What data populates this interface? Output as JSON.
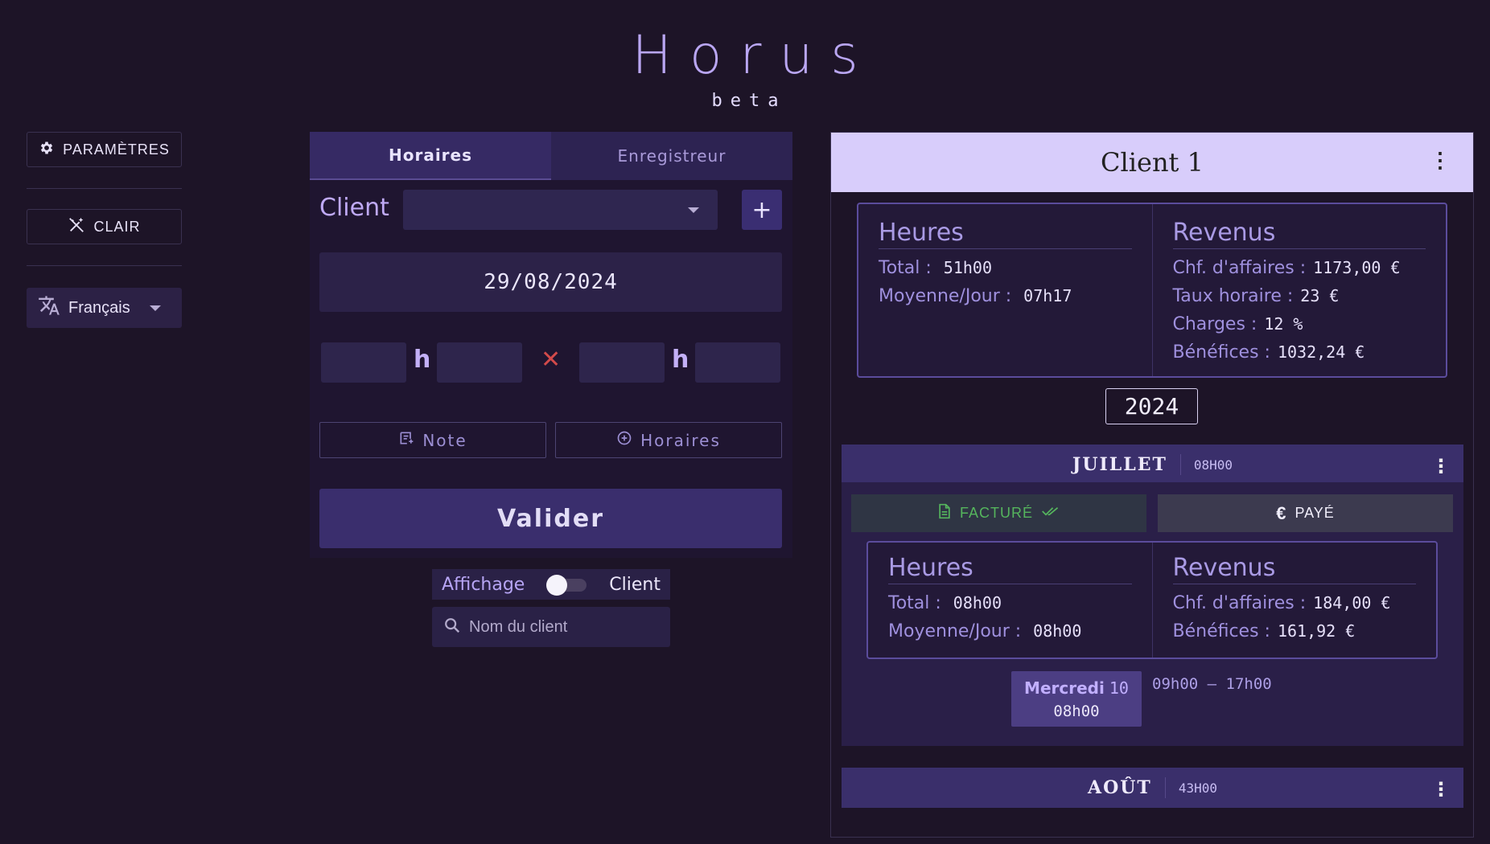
{
  "app": {
    "title": "Horus",
    "subtitle": "beta"
  },
  "sidebar": {
    "settings_label": "PARAMÈTRES",
    "theme_label": "CLAIR",
    "language_label": "Français"
  },
  "editor": {
    "tabs": [
      {
        "label": "Horaires",
        "active": true
      },
      {
        "label": "Enregistreur",
        "active": false
      }
    ],
    "client_label": "Client",
    "client_select_value": "",
    "date_value": "29/08/2024",
    "hour_separator": "h",
    "note_button": "Note",
    "hours_button": "Horaires",
    "validate_button": "Valider",
    "view_toggle": {
      "left_label": "Affichage",
      "right_label": "Client",
      "on": false
    },
    "search_placeholder": "Nom du client"
  },
  "client_panel": {
    "client_name": "Client 1",
    "summary": {
      "hours_title": "Heures",
      "total_label": "Total :",
      "total_value": "51h00",
      "avg_label": "Moyenne/Jour :",
      "avg_value": "07h17",
      "revenue_title": "Revenus",
      "turnover_label": "Chf. d'affaires :",
      "turnover_value": "1173,00 €",
      "rate_label": "Taux horaire :",
      "rate_value": "23 €",
      "charges_label": "Charges :",
      "charges_value": "12 %",
      "profit_label": "Bénéfices :",
      "profit_value": "1032,24 €"
    },
    "year": "2024",
    "months": [
      {
        "name": "JUILLET",
        "hours": "08H00",
        "invoiced_label": "FACTURÉ",
        "paid_label": "PAYÉ",
        "stats": {
          "hours_title": "Heures",
          "total_label": "Total :",
          "total_value": "08h00",
          "avg_label": "Moyenne/Jour :",
          "avg_value": "08h00",
          "revenue_title": "Revenus",
          "turnover_label": "Chf. d'affaires :",
          "turnover_value": "184,00 €",
          "profit_label": "Bénéfices :",
          "profit_value": "161,92 €"
        },
        "days": [
          {
            "day_name": "Mercredi",
            "day_num": "10",
            "duration": "08h00",
            "range": "09h00 – 17h00"
          }
        ]
      },
      {
        "name": "AOÛT",
        "hours": "43H00"
      }
    ]
  },
  "colors": {
    "background": "#1d1427",
    "accent": "#b9a6f2",
    "header_card": "#d8cdfb",
    "invoiced_green": "#55b55d",
    "cancel_red": "#d24a4a"
  }
}
